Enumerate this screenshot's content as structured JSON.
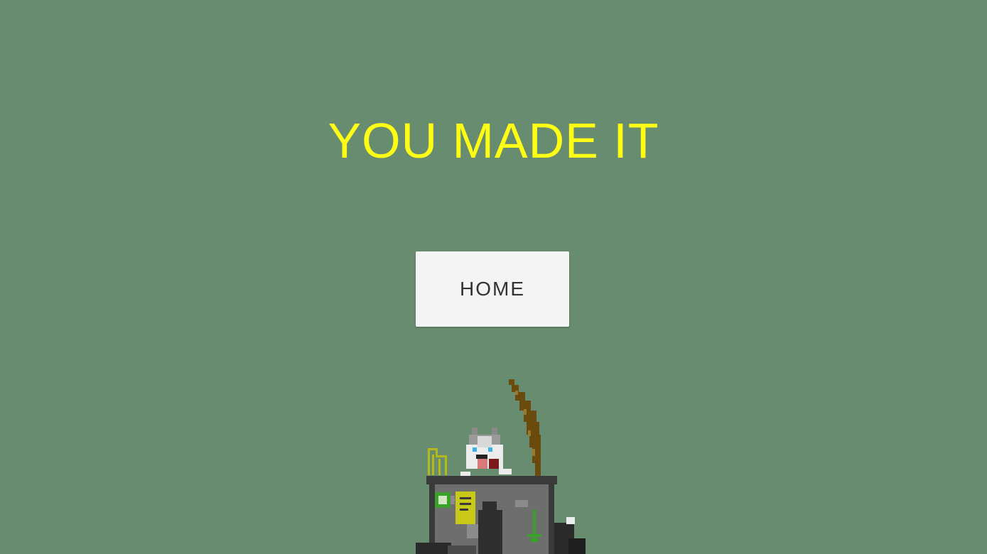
{
  "screen": {
    "title": "YOU MADE IT",
    "home_button_label": "HOME"
  },
  "colors": {
    "background": "#688c70",
    "title": "#ffff14",
    "button_bg": "#f4f4f4",
    "button_text": "#333333"
  },
  "scene": {
    "icons": [
      "husky-dog-icon",
      "trash-bin-icon",
      "open-lid-icon",
      "paperclip-icon",
      "down-arrow-icon",
      "trash-pile-icon"
    ]
  }
}
